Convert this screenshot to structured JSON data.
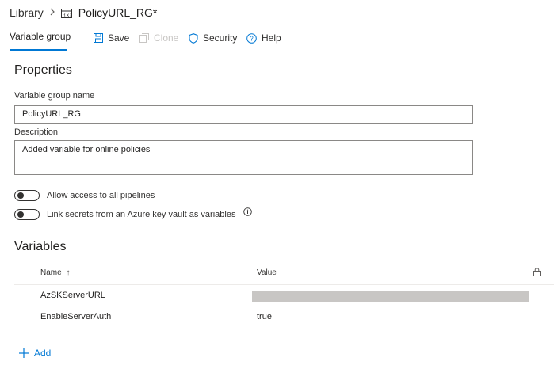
{
  "breadcrumb": {
    "root": "Library",
    "separator": ">",
    "title": "PolicyURL_RG*"
  },
  "toolbar": {
    "active_tab": "Variable group",
    "save": "Save",
    "clone": "Clone",
    "security": "Security",
    "help": "Help"
  },
  "properties": {
    "heading": "Properties",
    "name_label": "Variable group name",
    "name_value": "PolicyURL_RG",
    "description_label": "Description",
    "description_value": "Added variable for online policies",
    "toggle_pipelines": "Allow access to all pipelines",
    "toggle_keyvault": "Link secrets from an Azure key vault as variables",
    "toggle_pipelines_on": false,
    "toggle_keyvault_on": false
  },
  "variables": {
    "heading": "Variables",
    "columns": {
      "name": "Name",
      "sort_indicator": "↑",
      "value": "Value"
    },
    "rows": [
      {
        "name": "AzSKServerURL",
        "value": "",
        "secret": true
      },
      {
        "name": "EnableServerAuth",
        "value": "true",
        "secret": false
      }
    ],
    "add": "Add"
  },
  "colors": {
    "accent": "#0078d4",
    "text": "#201f1e",
    "disabled": "#c8c6c4",
    "border": "#8a8886"
  }
}
